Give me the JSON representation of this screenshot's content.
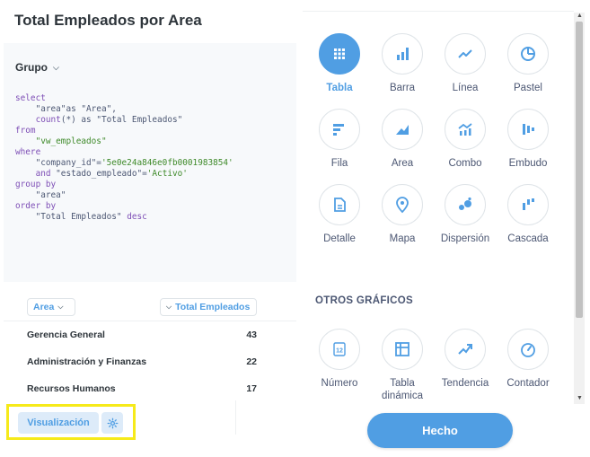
{
  "title": "Total Empleados por Area",
  "editor": {
    "grupo_label": "Grupo",
    "sql_lines": [
      [
        {
          "t": "select",
          "c": "kw"
        }
      ],
      [
        {
          "t": "    \"area\"as \"Area\",",
          "c": ""
        }
      ],
      [
        {
          "t": "    ",
          "c": ""
        },
        {
          "t": "count",
          "c": "kw"
        },
        {
          "t": "(*) as \"Total Empleados\"",
          "c": ""
        }
      ],
      [
        {
          "t": "from",
          "c": "kw"
        }
      ],
      [
        {
          "t": "    \"vw_empleados\"",
          "c": "str"
        }
      ],
      [
        {
          "t": "where",
          "c": "kw"
        }
      ],
      [
        {
          "t": "    \"company_id\"=",
          "c": ""
        },
        {
          "t": "'5e0e24a846e0fb0001983854'",
          "c": "str"
        }
      ],
      [
        {
          "t": "    ",
          "c": ""
        },
        {
          "t": "and",
          "c": "kw"
        },
        {
          "t": " \"estado_empleado\"=",
          "c": ""
        },
        {
          "t": "'Activo'",
          "c": "str"
        }
      ],
      [
        {
          "t": "group by",
          "c": "kw"
        }
      ],
      [
        {
          "t": "    \"area\"",
          "c": ""
        }
      ],
      [
        {
          "t": "order by",
          "c": "kw"
        }
      ],
      [
        {
          "t": "    \"Total Empleados\" ",
          "c": ""
        },
        {
          "t": "desc",
          "c": "kw"
        }
      ]
    ]
  },
  "table": {
    "headers": {
      "area": "Area",
      "total": "Total Empleados"
    },
    "rows": [
      {
        "area": "Gerencia General",
        "total": "43"
      },
      {
        "area": "Administración y Finanzas",
        "total": "22"
      },
      {
        "area": "Recursos Humanos",
        "total": "17"
      }
    ]
  },
  "bottom": {
    "visualizacion_label": "Visualización"
  },
  "chart_types": [
    {
      "label": "Tabla",
      "icon": "table-icon",
      "selected": true
    },
    {
      "label": "Barra",
      "icon": "bar-icon",
      "selected": false
    },
    {
      "label": "Línea",
      "icon": "line-icon",
      "selected": false
    },
    {
      "label": "Pastel",
      "icon": "pie-icon",
      "selected": false
    },
    {
      "label": "Fila",
      "icon": "row-icon",
      "selected": false
    },
    {
      "label": "Area",
      "icon": "area-icon",
      "selected": false
    },
    {
      "label": "Combo",
      "icon": "combo-icon",
      "selected": false
    },
    {
      "label": "Embudo",
      "icon": "funnel-icon",
      "selected": false
    },
    {
      "label": "Detalle",
      "icon": "detail-icon",
      "selected": false
    },
    {
      "label": "Mapa",
      "icon": "map-pin-icon",
      "selected": false
    },
    {
      "label": "Dispersión",
      "icon": "scatter-icon",
      "selected": false
    },
    {
      "label": "Cascada",
      "icon": "waterfall-icon",
      "selected": false
    }
  ],
  "otros_heading": "OTROS GRÁFICOS",
  "other_types": [
    {
      "label": "Número",
      "icon": "number-icon"
    },
    {
      "label": "Tabla dinámica",
      "icon": "pivot-icon"
    },
    {
      "label": "Tendencia",
      "icon": "trend-icon"
    },
    {
      "label": "Contador",
      "icon": "gauge-icon"
    }
  ],
  "done_label": "Hecho",
  "colors": {
    "accent": "#509ee3",
    "highlight": "#f6ea1a",
    "text": "#4c5773"
  }
}
